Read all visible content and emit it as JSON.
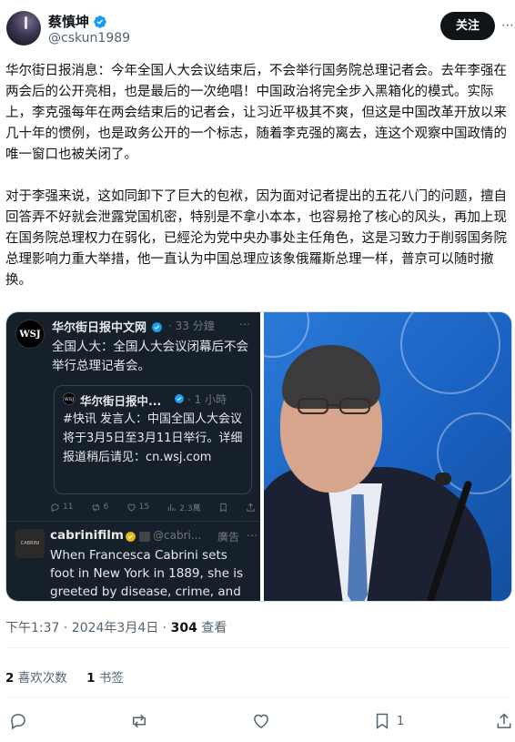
{
  "author": {
    "display_name": "蔡慎坤",
    "handle": "@cskun1989",
    "follow_label": "关注",
    "more_label": "⋯"
  },
  "tweet": {
    "paragraphs": [
      "华尔街日报消息：今年全国人大会议结束后，不会举行国务院总理记者会。去年李强在两会后的公开亮相，也是最后的一次绝唱！中国政治将完全步入黑箱化的模式。实际上，李克强每年在两会结束后的记者会，让习近平极其不爽，但这是中国改革开放以来几十年的惯例，也是政务公开的一个标志，随着李克强的离去，连这个观察中国政情的唯一窗口也被关闭了。",
      "对于李强来说，这如同卸下了巨大的包袱，因为面对记者提出的五花八门的问题，擅自回答弄不好就会泄露党国机密，特别是不拿小本本，也容易抢了核心的风头，再加上现在国务院总理权力在弱化，已經沦为党中央办事处主任角色，这是习致力于削弱国务院总理影响力重大举措，他一直认为中国总理应该象俄羅斯总理一样，普京可以随时撤换。"
    ]
  },
  "embedded": {
    "logo": "WSJ",
    "name": "华尔街日报中文网",
    "time": "· 33 分鐘",
    "more": "⋯",
    "text": "全国人大：全国人大会议闭幕后不会举行总理记者会。",
    "quote": {
      "logo": "WSJ",
      "name": "华尔街日报中...",
      "time": "· 1 小時",
      "text": "#快讯 发言人：中国全国人大会议将于3月5日至3月11日举行。详细报道稍后请见：cn.wsj.com"
    },
    "actions": {
      "replies": "11",
      "reposts": "6",
      "likes": "15",
      "views": "2.3萬"
    },
    "ad": {
      "avatar_label": "CABRINI",
      "name": "cabrinifilm",
      "handle": "@cabri...",
      "label": "廣告",
      "more": "⋯",
      "text": "When Francesca Cabrini sets foot in New York in 1889, she is greeted by disease, crime, and"
    }
  },
  "meta": {
    "time": "下午1:37 · 2024年3月4日 · ",
    "views_count": "304",
    "views_label": " 查看",
    "likes_count": "2",
    "likes_label": " 喜欢次数",
    "bookmarks_count": "1",
    "bookmarks_label": " 书签"
  },
  "actions": {
    "bookmark_count": "1"
  },
  "colors": {
    "verified": "#1d9bf0",
    "gold_badge": "#e2b719",
    "follow_bg": "#0f1419"
  }
}
